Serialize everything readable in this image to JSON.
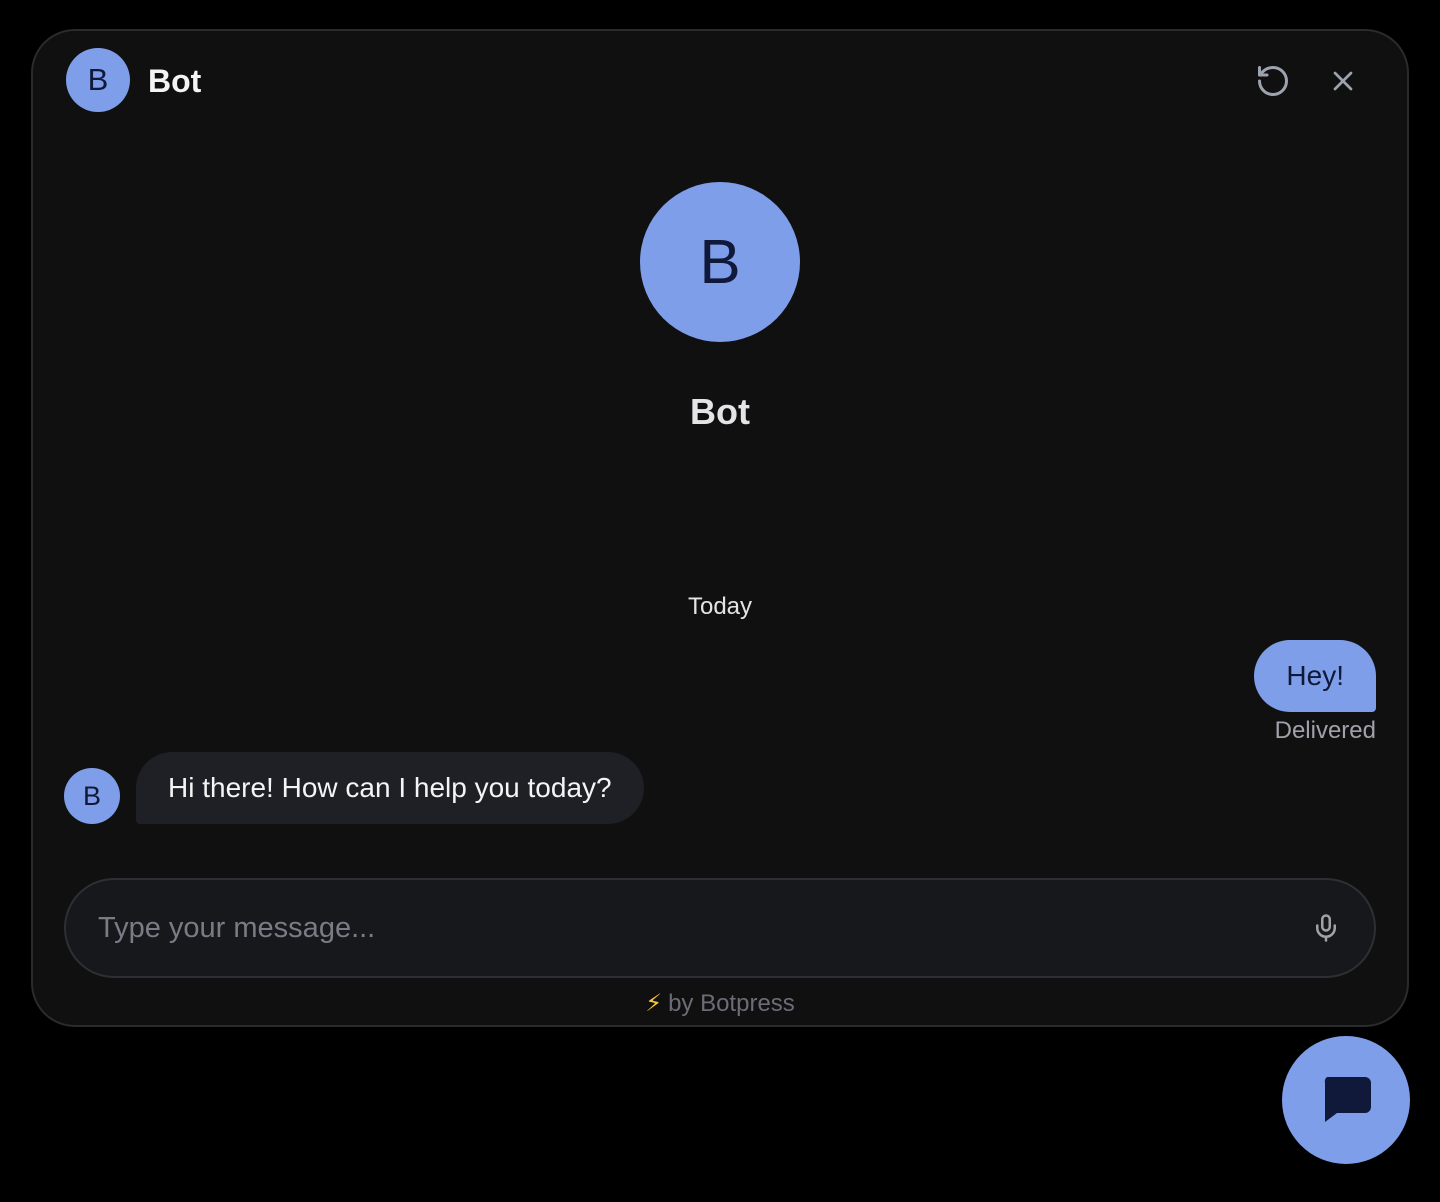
{
  "header": {
    "avatar_initial": "B",
    "title": "Bot"
  },
  "profile": {
    "avatar_initial": "B",
    "name": "Bot"
  },
  "conversation": {
    "date_divider": "Today",
    "messages": [
      {
        "sender": "user",
        "text": "Hey!",
        "status": "Delivered"
      },
      {
        "sender": "bot",
        "avatar_initial": "B",
        "text": "Hi there! How can I help you today?"
      }
    ]
  },
  "composer": {
    "placeholder": "Type your message...",
    "value": ""
  },
  "footer": {
    "powered_by": "by Botpress"
  },
  "icons": {
    "refresh": "refresh-icon",
    "close": "close-icon",
    "mic": "microphone-icon",
    "launcher": "chat-bubble-icon",
    "bolt": "bolt-icon"
  },
  "colors": {
    "accent": "#7f9ee9",
    "window_bg": "#101011",
    "bot_bubble": "#1f2026",
    "page_bg": "#000000"
  }
}
